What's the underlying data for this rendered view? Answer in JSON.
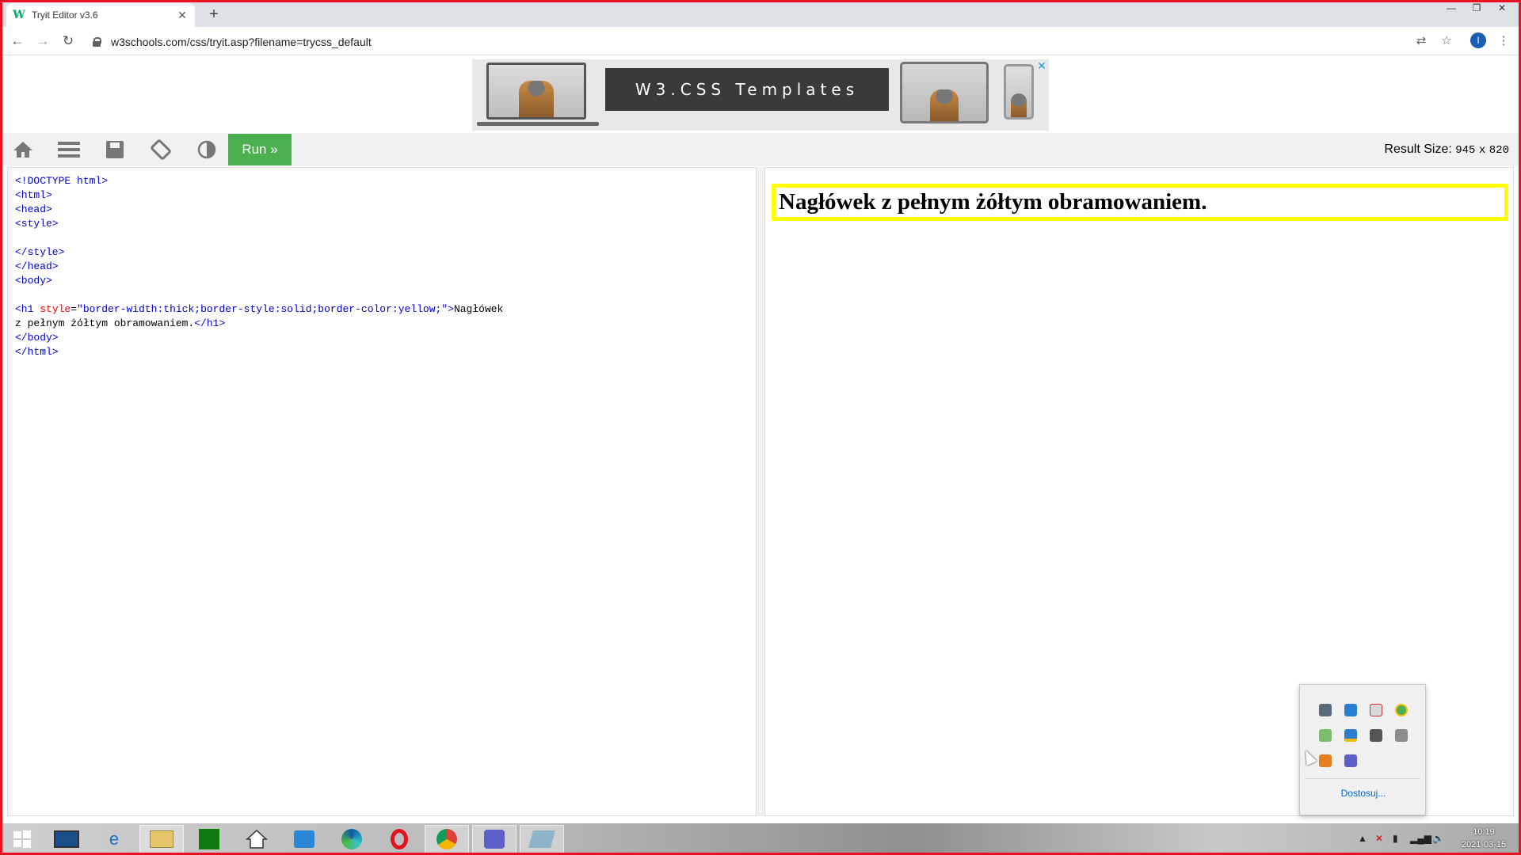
{
  "browser": {
    "tab_title": "Tryit Editor v3.6",
    "tab_favicon": "W",
    "url": "w3schools.com/css/tryit.asp?filename=trycss_default",
    "profile_initial": "I"
  },
  "ad": {
    "title": "W3.CSS Templates",
    "close": "✕"
  },
  "tryit": {
    "run_label": "Run »",
    "result_size_label": "Result Size:",
    "result_width": "945",
    "result_x": "x",
    "result_height": "820"
  },
  "code": {
    "line1": "<!DOCTYPE html>",
    "line2": "<html>",
    "line3": "<head>",
    "line4": "<style>",
    "line5": "</style>",
    "line6": "</head>",
    "line7": "<body>",
    "h1_open": "<h1",
    "h1_attr_name": "style",
    "h1_eq": "=",
    "h1_attr_val": "\"border-width:thick;border-style:solid;border-color:yellow;\"",
    "h1_close_bracket": ">",
    "h1_text1": "Nagłówek",
    "h1_text2": "z pełnym żółtym obramowaniem.",
    "h1_end": "</h1>",
    "line_body_end": "</body>",
    "line_html_end": "</html>"
  },
  "result": {
    "heading": "Nagłówek z pełnym żółtym obramowaniem."
  },
  "tray": {
    "customize": "Dostosuj..."
  },
  "taskbar": {
    "time": "10:19",
    "date": "2021-03-15"
  }
}
